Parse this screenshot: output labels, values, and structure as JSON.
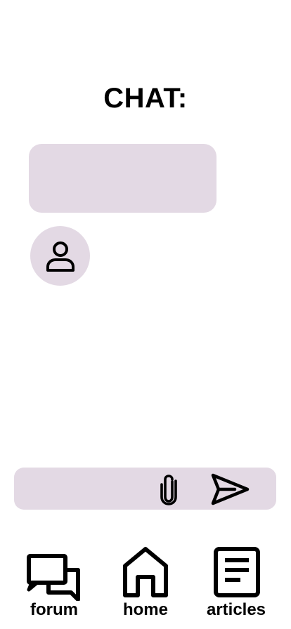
{
  "header": {
    "title": "CHAT:"
  },
  "chat": {
    "messages": [
      {
        "text": ""
      }
    ],
    "avatar_icon": "user-icon"
  },
  "composer": {
    "value": "",
    "placeholder": "",
    "attach_icon": "paperclip-icon",
    "send_icon": "send-icon"
  },
  "nav": {
    "items": [
      {
        "label": "forum",
        "icon": "forum-icon"
      },
      {
        "label": "home",
        "icon": "home-icon"
      },
      {
        "label": "articles",
        "icon": "articles-icon"
      }
    ]
  },
  "colors": {
    "accent": "#e3d9e4",
    "text": "#000000",
    "background": "#ffffff"
  }
}
